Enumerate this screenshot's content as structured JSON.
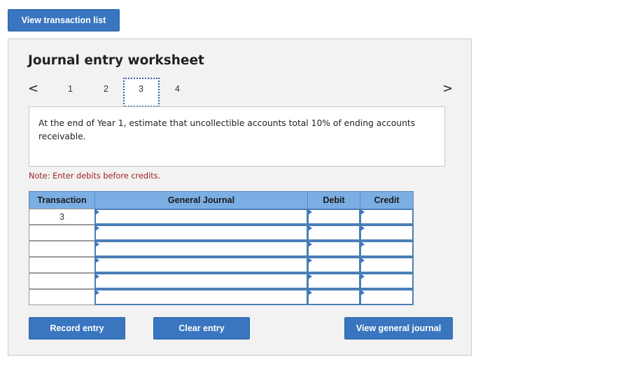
{
  "top_button": "View transaction list",
  "worksheet": {
    "title": "Journal entry worksheet",
    "prev_arrow": "<",
    "next_arrow": ">",
    "pages": [
      "1",
      "2",
      "3",
      "4"
    ],
    "current_page": "3",
    "description": "At the end of Year 1, estimate that uncollectible accounts total 10% of ending accounts receivable.",
    "note": "Note: Enter debits before credits."
  },
  "table": {
    "headers": [
      "Transaction",
      "General Journal",
      "Debit",
      "Credit"
    ],
    "rows": [
      {
        "transaction": "3",
        "account": "",
        "debit": "",
        "credit": ""
      },
      {
        "transaction": "",
        "account": "",
        "debit": "",
        "credit": ""
      },
      {
        "transaction": "",
        "account": "",
        "debit": "",
        "credit": ""
      },
      {
        "transaction": "",
        "account": "",
        "debit": "",
        "credit": ""
      },
      {
        "transaction": "",
        "account": "",
        "debit": "",
        "credit": ""
      },
      {
        "transaction": "",
        "account": "",
        "debit": "",
        "credit": ""
      }
    ]
  },
  "buttons": {
    "record": "Record entry",
    "clear": "Clear entry",
    "view_journal": "View general journal"
  },
  "colors": {
    "button_blue": "#3a76c0",
    "header_blue": "#7baee3",
    "note_red": "#a02020"
  }
}
